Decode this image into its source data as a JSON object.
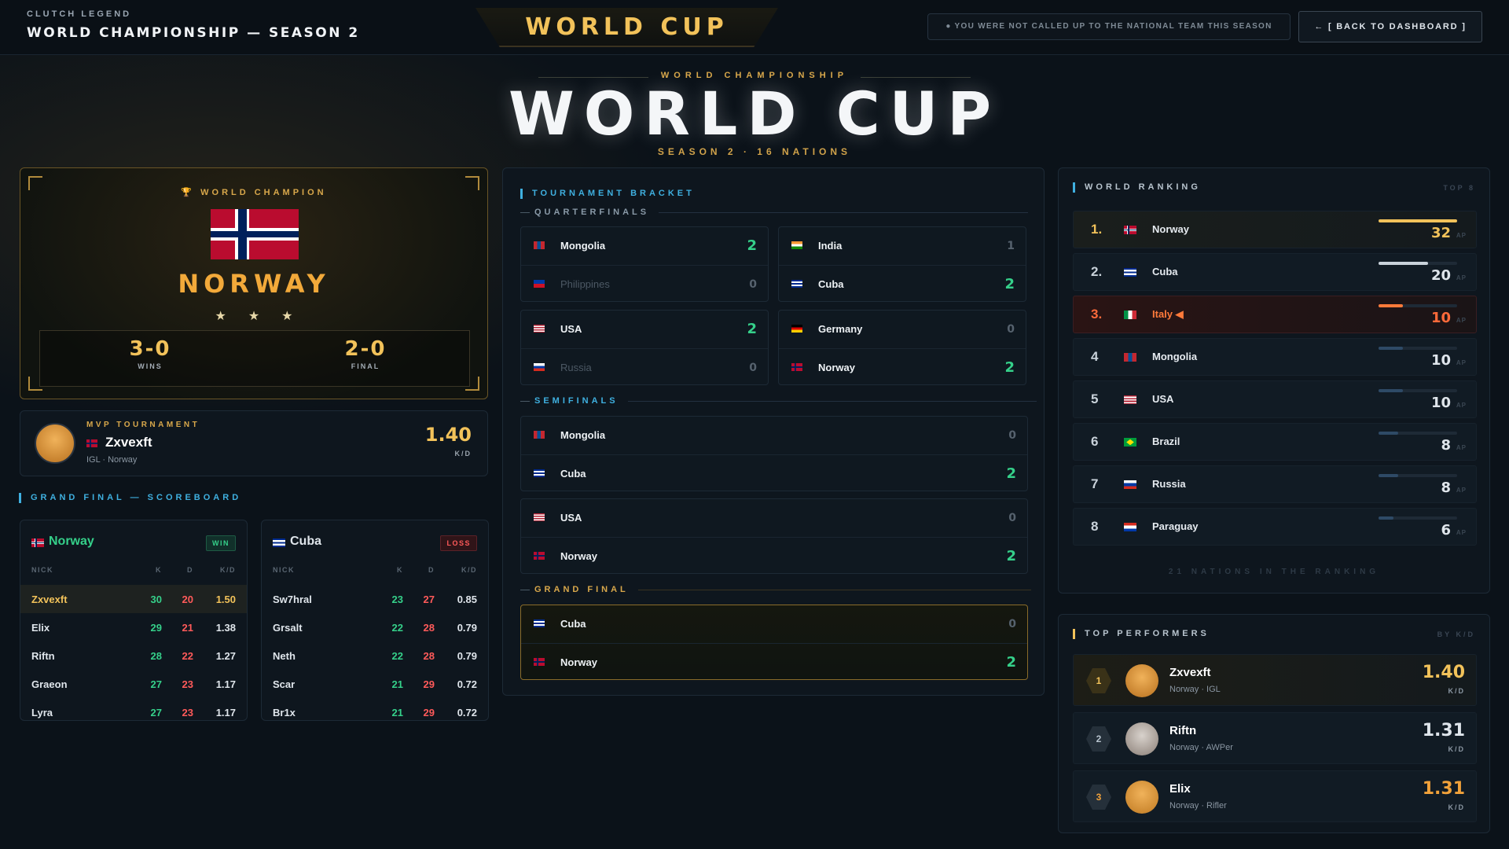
{
  "header": {
    "brand": "CLUTCH LEGEND",
    "subtitle": "WORLD CHAMPIONSHIP — SEASON 2",
    "center_title": "WORLD CUP",
    "notice": "● YOU WERE NOT CALLED UP TO THE NATIONAL TEAM THIS SEASON",
    "back_label": "← [ BACK TO DASHBOARD ]"
  },
  "hero": {
    "kicker": "WORLD CHAMPIONSHIP",
    "title": "WORLD CUP",
    "sub": "SEASON 2 · 16 NATIONS"
  },
  "champion": {
    "label": "🏆 WORLD CHAMPION",
    "name": "NORWAY",
    "stars": "★★★",
    "wins_value": "3-0",
    "wins_label": "WINS",
    "final_value": "2-0",
    "final_label": "FINAL"
  },
  "mvp": {
    "kicker": "MVP TOURNAMENT",
    "name": "Zxvexft",
    "sub": "IGL · Norway",
    "kd": "1.40",
    "kd_label": "K/D"
  },
  "grand_final_scoreboard": {
    "title": "GRAND FINAL — SCOREBOARD",
    "headers": {
      "nick": "NICK",
      "k": "K",
      "d": "D",
      "kd": "K/D"
    },
    "team_a": {
      "name": "Norway",
      "result": "WIN",
      "flag": "norway-flag",
      "players": [
        {
          "nick": "Zxvexft",
          "k": "30",
          "d": "20",
          "kd": "1.50"
        },
        {
          "nick": "Elix",
          "k": "29",
          "d": "21",
          "kd": "1.38"
        },
        {
          "nick": "Riftn",
          "k": "28",
          "d": "22",
          "kd": "1.27"
        },
        {
          "nick": "Graeon",
          "k": "27",
          "d": "23",
          "kd": "1.17"
        },
        {
          "nick": "Lyra",
          "k": "27",
          "d": "23",
          "kd": "1.17"
        }
      ]
    },
    "team_b": {
      "name": "Cuba",
      "result": "LOSS",
      "flag": "cuba-flag",
      "players": [
        {
          "nick": "Sw7hral",
          "k": "23",
          "d": "27",
          "kd": "0.85"
        },
        {
          "nick": "Grsalt",
          "k": "22",
          "d": "28",
          "kd": "0.79"
        },
        {
          "nick": "Neth",
          "k": "22",
          "d": "28",
          "kd": "0.79"
        },
        {
          "nick": "Scar",
          "k": "21",
          "d": "29",
          "kd": "0.72"
        },
        {
          "nick": "Br1x",
          "k": "21",
          "d": "29",
          "kd": "0.72"
        }
      ]
    }
  },
  "bracket": {
    "title": "TOURNAMENT BRACKET",
    "quarterfinals_label": "QUARTERFINALS",
    "semifinals_label": "SEMIFINALS",
    "grand_final_label": "GRAND FINAL",
    "quarterfinals": [
      {
        "a": "Mongolia",
        "a_score": "2",
        "b": "Philippines",
        "b_score": "0",
        "winner": "a"
      },
      {
        "a": "India",
        "a_score": "1",
        "b": "Cuba",
        "b_score": "2",
        "winner": "b"
      },
      {
        "a": "USA",
        "a_score": "2",
        "b": "Russia",
        "b_score": "0",
        "winner": "a"
      },
      {
        "a": "Germany",
        "a_score": "0",
        "b": "Norway",
        "b_score": "2",
        "winner": "b"
      }
    ],
    "semifinals": [
      {
        "a": "Mongolia",
        "a_score": "0",
        "b": "Cuba",
        "b_score": "2",
        "winner": "b"
      },
      {
        "a": "USA",
        "a_score": "0",
        "b": "Norway",
        "b_score": "2",
        "winner": "b"
      }
    ],
    "final": {
      "a": "Cuba",
      "a_score": "0",
      "b": "Norway",
      "b_score": "2",
      "winner": "b"
    }
  },
  "ranking": {
    "title": "WORLD RANKING",
    "top_label": "TOP 8",
    "unit": "AP",
    "rows": [
      {
        "pos": "1.",
        "name": "Norway",
        "pts": "32",
        "fill": 1.0,
        "color": "#f2c25a"
      },
      {
        "pos": "2.",
        "name": "Cuba",
        "pts": "20",
        "fill": 0.63,
        "color": "#c9d2da"
      },
      {
        "pos": "3.",
        "name": "Italy ◀",
        "pts": "10",
        "fill": 0.31,
        "color": "#ff7a3a"
      },
      {
        "pos": "4",
        "name": "Mongolia",
        "pts": "10",
        "fill": 0.31,
        "color": "#2e4a66"
      },
      {
        "pos": "5",
        "name": "USA",
        "pts": "10",
        "fill": 0.31,
        "color": "#2e4a66"
      },
      {
        "pos": "6",
        "name": "Brazil",
        "pts": "8",
        "fill": 0.25,
        "color": "#2e4a66"
      },
      {
        "pos": "7",
        "name": "Russia",
        "pts": "8",
        "fill": 0.25,
        "color": "#2e4a66"
      },
      {
        "pos": "8",
        "name": "Paraguay",
        "pts": "6",
        "fill": 0.19,
        "color": "#2e4a66"
      }
    ],
    "footer": "21 NATIONS IN THE RANKING"
  },
  "performers": {
    "title": "TOP PERFORMERS",
    "by_label": "BY K/D",
    "kd_label": "K/D",
    "rows": [
      {
        "rank": "1",
        "name": "Zxvexft",
        "sub": "Norway · IGL",
        "kd": "1.40",
        "color": "#f2c25a"
      },
      {
        "rank": "2",
        "name": "Riftn",
        "sub": "Norway · AWPer",
        "kd": "1.31",
        "color": "#dfe5eb"
      },
      {
        "rank": "3",
        "name": "Elix",
        "sub": "Norway · Rifler",
        "kd": "1.31",
        "color": "#f2a23a"
      }
    ]
  },
  "colors": {
    "accent_gold": "#f2c25a",
    "win_green": "#35d08a",
    "loss_red": "#ff5a5a",
    "accent_blue": "#3fb0e0"
  }
}
